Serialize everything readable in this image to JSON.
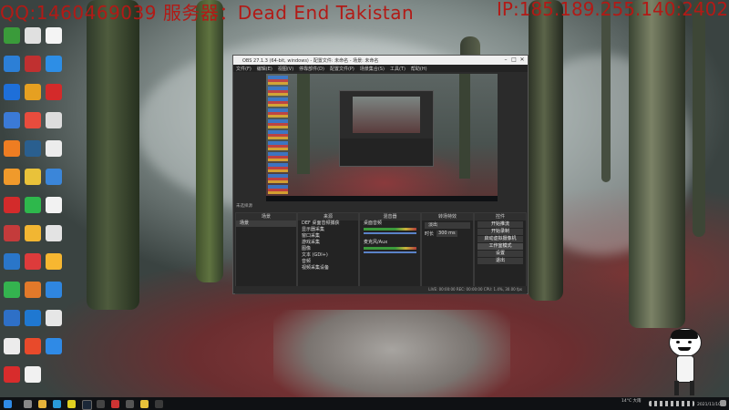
{
  "overlay": {
    "qq_line": "QQ:1460469039  服务器：Dead End Takistan",
    "ip_line": "IP:185.189.255.140:2402"
  },
  "obs": {
    "title": "OBS 27.1.3 (64-bit, windows) - 配置文件: 未命名 - 场景: 未命名",
    "menu": [
      "文件(F)",
      "编辑(E)",
      "视图(V)",
      "停靠部件(D)",
      "配置文件(P)",
      "场景集合(S)",
      "工具(T)",
      "帮助(H)"
    ],
    "audio_label": "未选择源",
    "docks": {
      "scenes_title": "场景",
      "scenes_item": "场景",
      "sources_title": "来源",
      "sources": [
        "DEF 桌面音频捕获",
        "显示器采集",
        "窗口采集",
        "游戏采集",
        "图像",
        "文本 (GDI+)",
        "音频",
        "视频采集设备"
      ],
      "mixer_title": "混音器",
      "mixer_channels": [
        "桌面音频",
        "麦克风/Aux"
      ],
      "transitions_title": "转场特效",
      "transition_name": "淡出",
      "transition_duration_label": "时长",
      "transition_duration_value": "300 ms",
      "controls_title": "控件",
      "controls": [
        "开始推流",
        "开始录制",
        "启动虚拟摄像机",
        "工作室模式",
        "设置",
        "退出"
      ]
    },
    "status": "LIVE: 00:00:00   REC: 00:00:00   CPU: 1.4%, 30.00 fps"
  },
  "taskbar": {
    "weather": "14°C 大雨",
    "time": "2021/11/10"
  }
}
